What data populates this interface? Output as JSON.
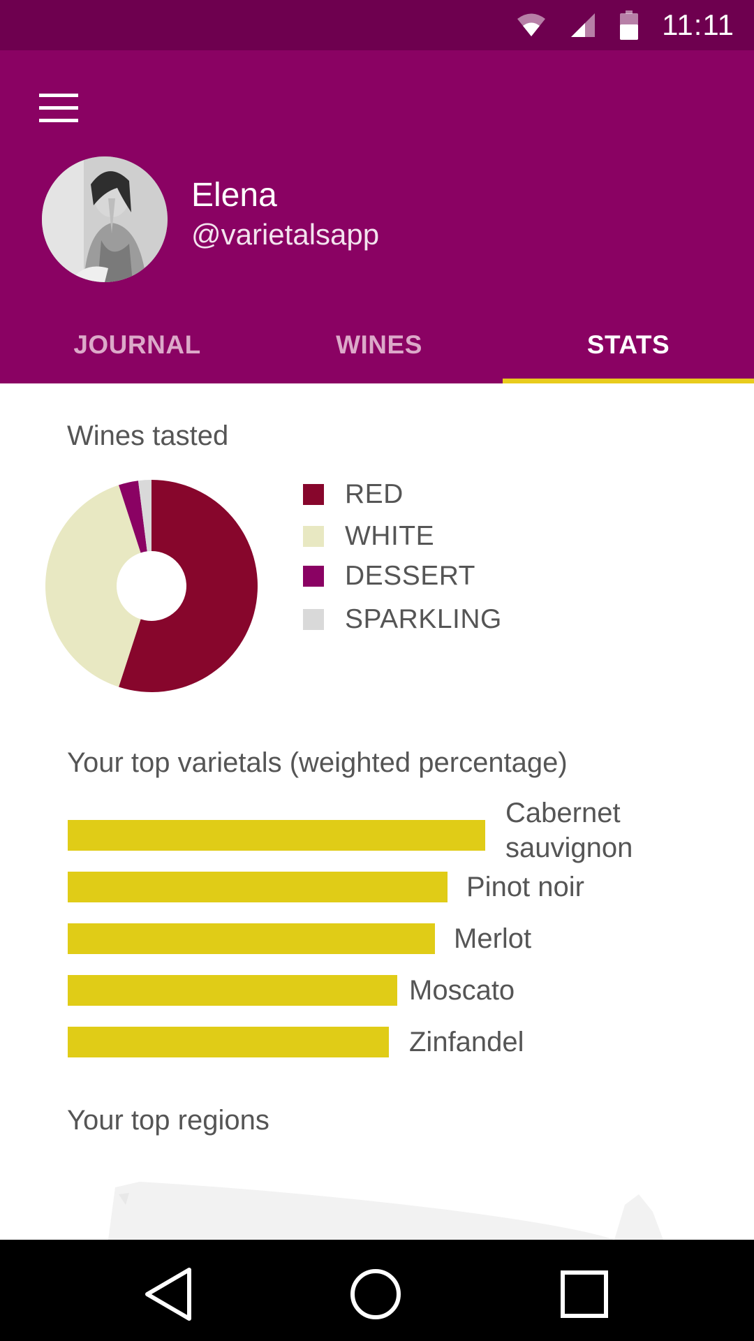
{
  "status_bar": {
    "time": "11:11"
  },
  "profile": {
    "name": "Elena",
    "handle": "@varietalsapp"
  },
  "tabs": [
    {
      "label": "JOURNAL"
    },
    {
      "label": "WINES"
    },
    {
      "label": "STATS"
    }
  ],
  "active_tab": "STATS",
  "colors": {
    "status_bar": "#6e004f",
    "header": "#8a0263",
    "tab_indicator": "#e8cc1d",
    "bar": "#e0cc17"
  },
  "wines_tasted": {
    "title": "Wines tasted",
    "chart_data": {
      "type": "pie",
      "style": "donut",
      "categories": [
        "RED",
        "WHITE",
        "DESSERT",
        "SPARKLING"
      ],
      "values": [
        55,
        40,
        3,
        2
      ],
      "colors": [
        "#87062c",
        "#e8e8c2",
        "#8a0263",
        "#d9d9d9"
      ]
    }
  },
  "top_varietals": {
    "title": "Your top varietals (weighted percentage)",
    "chart_data": {
      "type": "bar",
      "orientation": "horizontal",
      "categories": [
        "Cabernet sauvignon",
        "Pinot noir",
        "Merlot",
        "Moscato",
        "Zinfandel"
      ],
      "values": [
        100,
        91,
        88,
        79,
        77
      ],
      "xlim": [
        0,
        100
      ]
    }
  },
  "top_regions": {
    "title": "Your top regions"
  },
  "icons": [
    "wifi-icon",
    "signal-icon",
    "battery-icon",
    "menu-icon",
    "back-icon",
    "home-icon",
    "recents-icon"
  ]
}
